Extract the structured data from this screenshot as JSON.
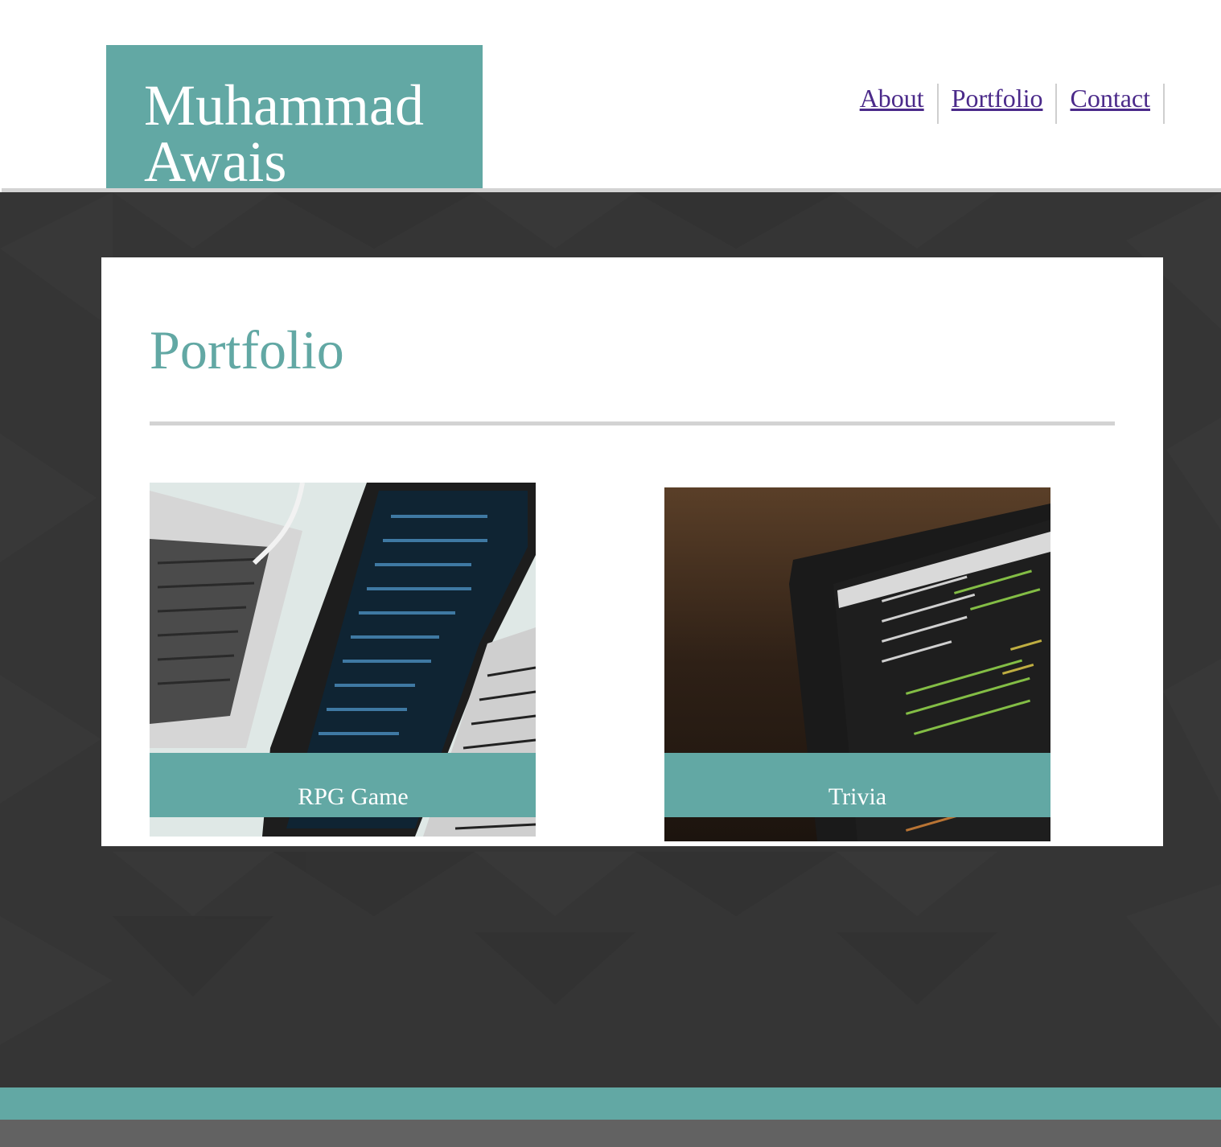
{
  "site": {
    "name": "Muhammad Awais",
    "brand_color": "#62a8a4",
    "link_color": "#4b2a8a"
  },
  "nav": {
    "items": [
      {
        "label": "About"
      },
      {
        "label": "Portfolio"
      },
      {
        "label": "Contact"
      }
    ]
  },
  "page": {
    "title": "Portfolio"
  },
  "projects": [
    {
      "title": "RPG Game",
      "image": "laptop-code-photo"
    },
    {
      "title": "Trivia",
      "image": "monitor-code-photo"
    }
  ]
}
